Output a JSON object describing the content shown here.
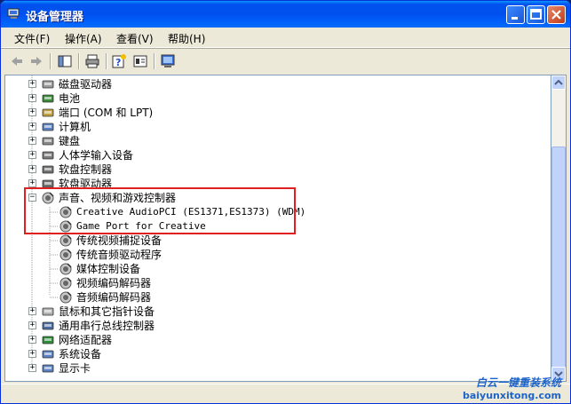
{
  "window": {
    "title": "设备管理器"
  },
  "menu": [
    {
      "label": "文件(F)"
    },
    {
      "label": "操作(A)"
    },
    {
      "label": "查看(V)"
    },
    {
      "label": "帮助(H)"
    }
  ],
  "tree": {
    "items": [
      {
        "label": "磁盘驱动器",
        "icon": "disk-drive-icon",
        "expanded": false
      },
      {
        "label": "电池",
        "icon": "battery-icon",
        "expanded": false
      },
      {
        "label": "端口 (COM 和 LPT)",
        "icon": "port-icon",
        "expanded": false
      },
      {
        "label": "计算机",
        "icon": "computer-icon",
        "expanded": false
      },
      {
        "label": "键盘",
        "icon": "keyboard-icon",
        "expanded": false
      },
      {
        "label": "人体学输入设备",
        "icon": "hid-icon",
        "expanded": false
      },
      {
        "label": "软盘控制器",
        "icon": "floppy-controller-icon",
        "expanded": false
      },
      {
        "label": "软盘驱动器",
        "icon": "floppy-drive-icon",
        "expanded": false
      },
      {
        "label": "声音、视频和游戏控制器",
        "icon": "sound-icon",
        "expanded": true,
        "children": [
          {
            "label": "Creative AudioPCI (ES1371,ES1373) (WDM)",
            "icon": "speaker-icon"
          },
          {
            "label": "Game Port for Creative",
            "icon": "speaker-icon"
          },
          {
            "label": "传统视频捕捉设备",
            "icon": "speaker-icon"
          },
          {
            "label": "传统音频驱动程序",
            "icon": "speaker-icon"
          },
          {
            "label": "媒体控制设备",
            "icon": "speaker-icon"
          },
          {
            "label": "视频编码解码器",
            "icon": "speaker-icon"
          },
          {
            "label": "音频编码解码器",
            "icon": "speaker-icon"
          }
        ]
      },
      {
        "label": "鼠标和其它指针设备",
        "icon": "mouse-icon",
        "expanded": false
      },
      {
        "label": "通用串行总线控制器",
        "icon": "usb-icon",
        "expanded": false
      },
      {
        "label": "网络适配器",
        "icon": "network-adapter-icon",
        "expanded": false
      },
      {
        "label": "系统设备",
        "icon": "system-device-icon",
        "expanded": false
      },
      {
        "label": "显示卡",
        "icon": "display-adapter-icon",
        "expanded": false
      }
    ]
  },
  "watermark": {
    "line1": "白云一键重装系统",
    "line2": "baiyunxitong.com"
  },
  "colors": {
    "titlebar": "#0054E3",
    "highlight": "#E02020",
    "watermark": "#1E64C8"
  }
}
